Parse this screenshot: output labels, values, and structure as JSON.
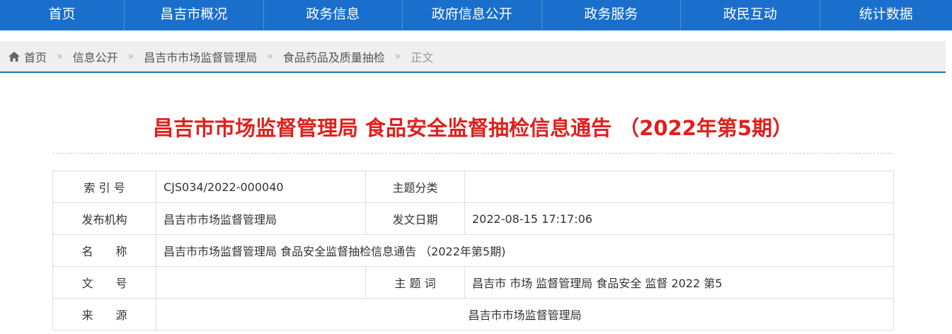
{
  "nav": {
    "items": [
      "首页",
      "昌吉市概况",
      "政务信息",
      "政府信息公开",
      "政务服务",
      "政民互动",
      "统计数据"
    ]
  },
  "breadcrumb": {
    "items": [
      "首页",
      "信息公开",
      "昌吉市市场监督管理局",
      "食品药品及质量抽检"
    ],
    "current": "正文",
    "separator": "»"
  },
  "article": {
    "title": "昌吉市市场监督管理局 食品安全监督抽检信息通告 （2022年第5期）"
  },
  "info": {
    "index_label": "索 引 号",
    "index_value": "CJS034/2022-000040",
    "category_label": "主题分类",
    "category_value": "",
    "publisher_label": "发布机构",
    "publisher_value": "昌吉市市场监督管理局",
    "date_label": "发文日期",
    "date_value": "2022-08-15 17:17:06",
    "name_label": "名　　称",
    "name_value": "昌吉市市场监督管理局 食品安全监督抽检信息通告 （2022年第5期)",
    "doc_label": "文　　号",
    "doc_value": "",
    "keywords_label": "主 题 词",
    "keywords_value": "昌吉市 市场 监督管理局 食品安全 监督 2022 第5",
    "source_label": "来　　源",
    "source_value": "昌吉市市场监督管理局"
  },
  "colors": {
    "nav_bg": "#1a6fcd",
    "title": "#e0201c"
  }
}
